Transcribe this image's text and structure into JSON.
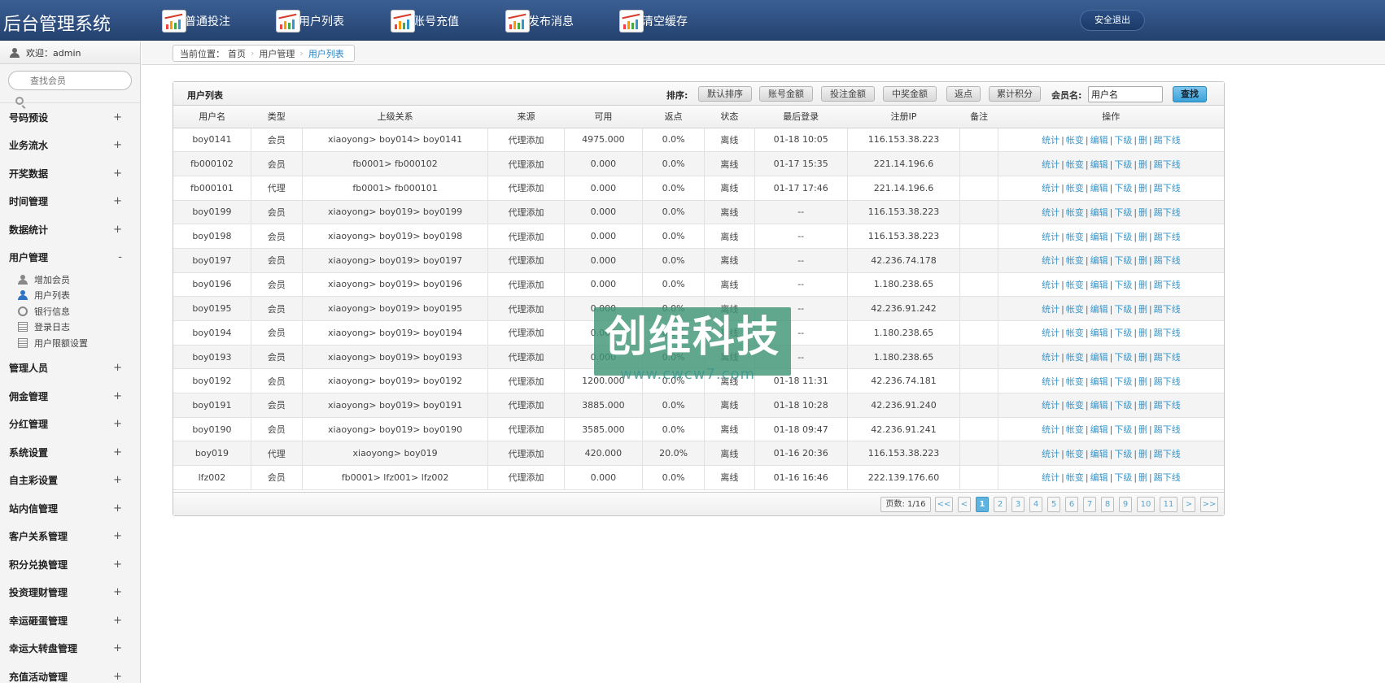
{
  "app": {
    "title": "后台管理系统",
    "logout_label": "安全退出"
  },
  "topnav": [
    "普通投注",
    "用户列表",
    "账号充值",
    "发布消息",
    "清空缓存"
  ],
  "sidebar": {
    "welcome": "欢迎：admin",
    "search_placeholder": "查找会员",
    "menu_before": [
      {
        "label": "号码预设",
        "sign": "+"
      },
      {
        "label": "业务流水",
        "sign": "+"
      },
      {
        "label": "开奖数据",
        "sign": "+"
      },
      {
        "label": "时间管理",
        "sign": "+"
      },
      {
        "label": "数据统计",
        "sign": "+"
      },
      {
        "label": "用户管理",
        "sign": "-"
      }
    ],
    "submenu": [
      {
        "label": "增加会员",
        "icon": "user-icon"
      },
      {
        "label": "用户列表",
        "icon": "user-icon"
      },
      {
        "label": "银行信息",
        "icon": "ring-icon"
      },
      {
        "label": "登录日志",
        "icon": "document-icon"
      },
      {
        "label": "用户限额设置",
        "icon": "document-icon"
      }
    ],
    "menu_after": [
      {
        "label": "管理人员",
        "sign": "+"
      },
      {
        "label": "佣金管理",
        "sign": "+"
      },
      {
        "label": "分红管理",
        "sign": "+"
      },
      {
        "label": "系统设置",
        "sign": "+"
      },
      {
        "label": "自主彩设置",
        "sign": "+"
      },
      {
        "label": "站内信管理",
        "sign": "+"
      },
      {
        "label": "客户关系管理",
        "sign": "+"
      },
      {
        "label": "积分兑换管理",
        "sign": "+"
      },
      {
        "label": "投资理财管理",
        "sign": "+"
      },
      {
        "label": "幸运砸蛋管理",
        "sign": "+"
      },
      {
        "label": "幸运大转盘管理",
        "sign": "+"
      },
      {
        "label": "充值活动管理",
        "sign": "+"
      }
    ]
  },
  "breadcrumb": {
    "prefix": "当前位置：",
    "items": [
      "首页",
      "用户管理",
      "用户列表"
    ]
  },
  "panel": {
    "title": "用户列表",
    "sort_label": "排序:",
    "sort_buttons": [
      "默认排序",
      "账号金额",
      "投注金额",
      "中奖金额",
      "返点",
      "累计积分"
    ],
    "member_label": "会员名:",
    "member_value": "用户名",
    "find_label": "查找"
  },
  "table": {
    "headers": [
      "用户名",
      "类型",
      "上级关系",
      "来源",
      "可用",
      "返点",
      "状态",
      "最后登录",
      "注册IP",
      "备注",
      "操作"
    ],
    "ops": [
      "统计",
      "帐变",
      "编辑",
      "下级",
      "删",
      "踢下线"
    ],
    "rows": [
      [
        "boy0141",
        "会员",
        "xiaoyong> boy014> boy0141",
        "代理添加",
        "4975.000",
        "0.0%",
        "离线",
        "01-18 10:05",
        "116.153.38.223",
        ""
      ],
      [
        "fb000102",
        "会员",
        "fb0001> fb000102",
        "代理添加",
        "0.000",
        "0.0%",
        "离线",
        "01-17 15:35",
        "221.14.196.6",
        ""
      ],
      [
        "fb000101",
        "代理",
        "fb0001> fb000101",
        "代理添加",
        "0.000",
        "0.0%",
        "离线",
        "01-17 17:46",
        "221.14.196.6",
        ""
      ],
      [
        "boy0199",
        "会员",
        "xiaoyong> boy019> boy0199",
        "代理添加",
        "0.000",
        "0.0%",
        "离线",
        "--",
        "116.153.38.223",
        ""
      ],
      [
        "boy0198",
        "会员",
        "xiaoyong> boy019> boy0198",
        "代理添加",
        "0.000",
        "0.0%",
        "离线",
        "--",
        "116.153.38.223",
        ""
      ],
      [
        "boy0197",
        "会员",
        "xiaoyong> boy019> boy0197",
        "代理添加",
        "0.000",
        "0.0%",
        "离线",
        "--",
        "42.236.74.178",
        ""
      ],
      [
        "boy0196",
        "会员",
        "xiaoyong> boy019> boy0196",
        "代理添加",
        "0.000",
        "0.0%",
        "离线",
        "--",
        "1.180.238.65",
        ""
      ],
      [
        "boy0195",
        "会员",
        "xiaoyong> boy019> boy0195",
        "代理添加",
        "0.000",
        "0.0%",
        "离线",
        "--",
        "42.236.91.242",
        ""
      ],
      [
        "boy0194",
        "会员",
        "xiaoyong> boy019> boy0194",
        "代理添加",
        "0.000",
        "0.0%",
        "离线",
        "--",
        "1.180.238.65",
        ""
      ],
      [
        "boy0193",
        "会员",
        "xiaoyong> boy019> boy0193",
        "代理添加",
        "0.000",
        "0.0%",
        "离线",
        "--",
        "1.180.238.65",
        ""
      ],
      [
        "boy0192",
        "会员",
        "xiaoyong> boy019> boy0192",
        "代理添加",
        "1200.000",
        "0.0%",
        "离线",
        "01-18 11:31",
        "42.236.74.181",
        ""
      ],
      [
        "boy0191",
        "会员",
        "xiaoyong> boy019> boy0191",
        "代理添加",
        "3885.000",
        "0.0%",
        "离线",
        "01-18 10:28",
        "42.236.91.240",
        ""
      ],
      [
        "boy0190",
        "会员",
        "xiaoyong> boy019> boy0190",
        "代理添加",
        "3585.000",
        "0.0%",
        "离线",
        "01-18 09:47",
        "42.236.91.241",
        ""
      ],
      [
        "boy019",
        "代理",
        "xiaoyong> boy019",
        "代理添加",
        "420.000",
        "20.0%",
        "离线",
        "01-16 20:36",
        "116.153.38.223",
        ""
      ],
      [
        "lfz002",
        "会员",
        "fb0001> lfz001> lfz002",
        "代理添加",
        "0.000",
        "0.0%",
        "离线",
        "01-16 16:46",
        "222.139.176.60",
        ""
      ]
    ]
  },
  "pager": {
    "info": "页数: 1/16",
    "buttons": [
      "<<",
      "<",
      "1",
      "2",
      "3",
      "4",
      "5",
      "6",
      "7",
      "8",
      "9",
      "10",
      "11",
      ">",
      ">>"
    ],
    "active": "1"
  },
  "watermark": {
    "text": "创维科技",
    "url": "www.cwcw7.com"
  }
}
